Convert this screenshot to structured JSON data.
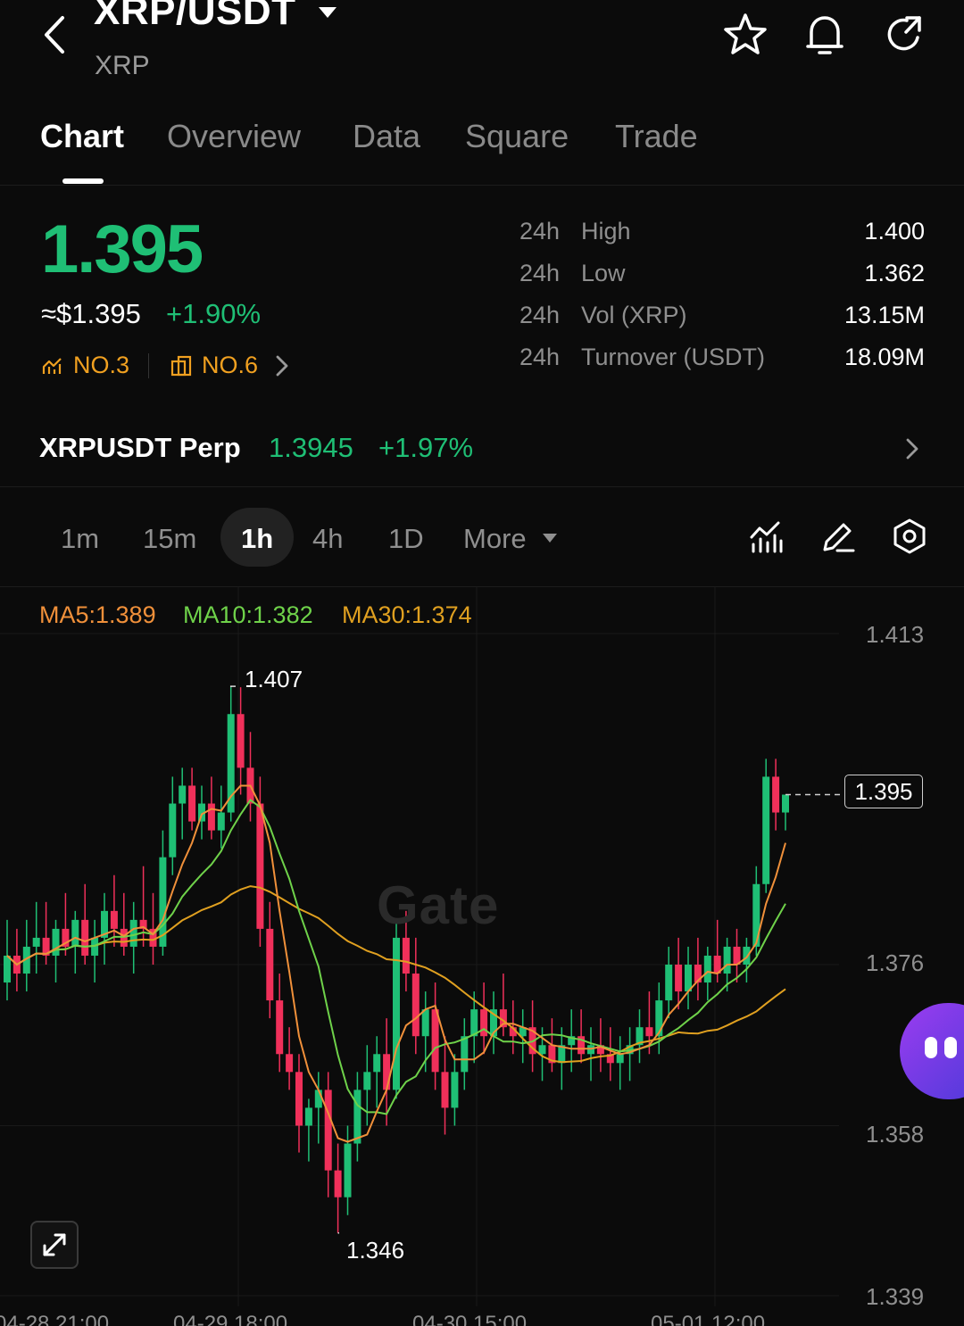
{
  "header": {
    "pair": "XRP/USDT",
    "base_asset": "XRP",
    "icons": [
      "back-icon",
      "star-icon",
      "bell-icon",
      "share-icon"
    ]
  },
  "tabs": [
    {
      "label": "Chart",
      "active": true
    },
    {
      "label": "Overview",
      "active": false
    },
    {
      "label": "Data",
      "active": false
    },
    {
      "label": "Square",
      "active": false
    },
    {
      "label": "Trade",
      "active": false
    }
  ],
  "price": {
    "last": "1.395",
    "usd": "≈$1.395",
    "change_pct": "+1.90%",
    "rank_hot": "NO.3",
    "rank_sector": "NO.6"
  },
  "stats": [
    {
      "period": "24h",
      "label": "High",
      "value": "1.400"
    },
    {
      "period": "24h",
      "label": "Low",
      "value": "1.362"
    },
    {
      "period": "24h",
      "label": "Vol (XRP)",
      "value": "13.15M"
    },
    {
      "period": "24h",
      "label": "Turnover (USDT)",
      "value": "18.09M"
    }
  ],
  "perp": {
    "name": "XRPUSDT Perp",
    "price": "1.3945",
    "change_pct": "+1.97%"
  },
  "intervals": {
    "items": [
      "1m",
      "15m",
      "1h",
      "4h",
      "1D"
    ],
    "active": "1h",
    "more_label": "More"
  },
  "chart": {
    "ma5": "MA5:1.389",
    "ma10": "MA10:1.382",
    "ma30": "MA30:1.374",
    "y_ticks": [
      "1.413",
      "1.376",
      "1.358",
      "1.339"
    ],
    "current_price": "1.395",
    "high_marker": "1.407",
    "low_marker": "1.346",
    "x_ticks": [
      "04-28 21:00",
      "04-29 18:00",
      "04-30 15:00",
      "05-01 12:00"
    ],
    "watermark": "Gate"
  },
  "colors": {
    "up": "#1fbf75",
    "down": "#f0305a",
    "ma5": "#f0903a",
    "ma10": "#6fd24a",
    "ma30": "#e0a020",
    "background": "#0b0b0b"
  },
  "chart_data": {
    "type": "candlestick",
    "interval": "1h",
    "ylim": [
      1.339,
      1.413
    ],
    "y_ticks": [
      1.413,
      1.376,
      1.358,
      1.339
    ],
    "x_ticks": [
      "04-28 21:00",
      "04-29 18:00",
      "04-30 15:00",
      "05-01 12:00"
    ],
    "last_price": 1.395,
    "visible_high": 1.407,
    "visible_low": 1.346,
    "grid": true,
    "candles": [
      {
        "o": 1.374,
        "h": 1.381,
        "l": 1.372,
        "c": 1.377
      },
      {
        "o": 1.377,
        "h": 1.38,
        "l": 1.373,
        "c": 1.375
      },
      {
        "o": 1.375,
        "h": 1.381,
        "l": 1.373,
        "c": 1.378
      },
      {
        "o": 1.378,
        "h": 1.383,
        "l": 1.375,
        "c": 1.379
      },
      {
        "o": 1.379,
        "h": 1.383,
        "l": 1.376,
        "c": 1.377
      },
      {
        "o": 1.377,
        "h": 1.381,
        "l": 1.374,
        "c": 1.38
      },
      {
        "o": 1.38,
        "h": 1.384,
        "l": 1.377,
        "c": 1.378
      },
      {
        "o": 1.378,
        "h": 1.382,
        "l": 1.375,
        "c": 1.381
      },
      {
        "o": 1.381,
        "h": 1.385,
        "l": 1.376,
        "c": 1.377
      },
      {
        "o": 1.377,
        "h": 1.381,
        "l": 1.374,
        "c": 1.379
      },
      {
        "o": 1.379,
        "h": 1.384,
        "l": 1.376,
        "c": 1.382
      },
      {
        "o": 1.382,
        "h": 1.386,
        "l": 1.378,
        "c": 1.38
      },
      {
        "o": 1.38,
        "h": 1.384,
        "l": 1.377,
        "c": 1.378
      },
      {
        "o": 1.378,
        "h": 1.383,
        "l": 1.375,
        "c": 1.381
      },
      {
        "o": 1.381,
        "h": 1.387,
        "l": 1.378,
        "c": 1.38
      },
      {
        "o": 1.38,
        "h": 1.384,
        "l": 1.376,
        "c": 1.378
      },
      {
        "o": 1.378,
        "h": 1.391,
        "l": 1.377,
        "c": 1.388
      },
      {
        "o": 1.388,
        "h": 1.397,
        "l": 1.386,
        "c": 1.394
      },
      {
        "o": 1.394,
        "h": 1.398,
        "l": 1.39,
        "c": 1.396
      },
      {
        "o": 1.396,
        "h": 1.398,
        "l": 1.391,
        "c": 1.392
      },
      {
        "o": 1.392,
        "h": 1.396,
        "l": 1.39,
        "c": 1.394
      },
      {
        "o": 1.394,
        "h": 1.397,
        "l": 1.39,
        "c": 1.391
      },
      {
        "o": 1.391,
        "h": 1.396,
        "l": 1.389,
        "c": 1.393
      },
      {
        "o": 1.393,
        "h": 1.407,
        "l": 1.392,
        "c": 1.404
      },
      {
        "o": 1.404,
        "h": 1.407,
        "l": 1.395,
        "c": 1.398
      },
      {
        "o": 1.398,
        "h": 1.402,
        "l": 1.392,
        "c": 1.394
      },
      {
        "o": 1.394,
        "h": 1.397,
        "l": 1.378,
        "c": 1.38
      },
      {
        "o": 1.38,
        "h": 1.383,
        "l": 1.37,
        "c": 1.372
      },
      {
        "o": 1.372,
        "h": 1.375,
        "l": 1.364,
        "c": 1.366
      },
      {
        "o": 1.366,
        "h": 1.369,
        "l": 1.362,
        "c": 1.364
      },
      {
        "o": 1.364,
        "h": 1.366,
        "l": 1.355,
        "c": 1.358
      },
      {
        "o": 1.358,
        "h": 1.361,
        "l": 1.354,
        "c": 1.36
      },
      {
        "o": 1.36,
        "h": 1.364,
        "l": 1.356,
        "c": 1.362
      },
      {
        "o": 1.362,
        "h": 1.364,
        "l": 1.35,
        "c": 1.353
      },
      {
        "o": 1.353,
        "h": 1.356,
        "l": 1.346,
        "c": 1.35
      },
      {
        "o": 1.35,
        "h": 1.358,
        "l": 1.348,
        "c": 1.356
      },
      {
        "o": 1.356,
        "h": 1.364,
        "l": 1.354,
        "c": 1.362
      },
      {
        "o": 1.362,
        "h": 1.367,
        "l": 1.358,
        "c": 1.364
      },
      {
        "o": 1.364,
        "h": 1.368,
        "l": 1.36,
        "c": 1.366
      },
      {
        "o": 1.366,
        "h": 1.37,
        "l": 1.358,
        "c": 1.362
      },
      {
        "o": 1.362,
        "h": 1.381,
        "l": 1.361,
        "c": 1.379
      },
      {
        "o": 1.379,
        "h": 1.382,
        "l": 1.373,
        "c": 1.375
      },
      {
        "o": 1.375,
        "h": 1.379,
        "l": 1.366,
        "c": 1.368
      },
      {
        "o": 1.368,
        "h": 1.373,
        "l": 1.364,
        "c": 1.371
      },
      {
        "o": 1.371,
        "h": 1.374,
        "l": 1.362,
        "c": 1.364
      },
      {
        "o": 1.364,
        "h": 1.368,
        "l": 1.357,
        "c": 1.36
      },
      {
        "o": 1.36,
        "h": 1.366,
        "l": 1.358,
        "c": 1.364
      },
      {
        "o": 1.364,
        "h": 1.37,
        "l": 1.362,
        "c": 1.368
      },
      {
        "o": 1.368,
        "h": 1.373,
        "l": 1.365,
        "c": 1.371
      },
      {
        "o": 1.371,
        "h": 1.374,
        "l": 1.366,
        "c": 1.368
      },
      {
        "o": 1.368,
        "h": 1.373,
        "l": 1.366,
        "c": 1.371
      },
      {
        "o": 1.371,
        "h": 1.375,
        "l": 1.368,
        "c": 1.369
      },
      {
        "o": 1.369,
        "h": 1.372,
        "l": 1.366,
        "c": 1.368
      },
      {
        "o": 1.368,
        "h": 1.371,
        "l": 1.365,
        "c": 1.369
      },
      {
        "o": 1.369,
        "h": 1.372,
        "l": 1.364,
        "c": 1.366
      },
      {
        "o": 1.366,
        "h": 1.369,
        "l": 1.363,
        "c": 1.367
      },
      {
        "o": 1.367,
        "h": 1.37,
        "l": 1.364,
        "c": 1.365
      },
      {
        "o": 1.365,
        "h": 1.369,
        "l": 1.362,
        "c": 1.367
      },
      {
        "o": 1.367,
        "h": 1.371,
        "l": 1.364,
        "c": 1.368
      },
      {
        "o": 1.368,
        "h": 1.371,
        "l": 1.365,
        "c": 1.366
      },
      {
        "o": 1.366,
        "h": 1.369,
        "l": 1.363,
        "c": 1.367
      },
      {
        "o": 1.367,
        "h": 1.37,
        "l": 1.364,
        "c": 1.366
      },
      {
        "o": 1.366,
        "h": 1.369,
        "l": 1.363,
        "c": 1.365
      },
      {
        "o": 1.365,
        "h": 1.368,
        "l": 1.362,
        "c": 1.366
      },
      {
        "o": 1.366,
        "h": 1.369,
        "l": 1.363,
        "c": 1.367
      },
      {
        "o": 1.367,
        "h": 1.371,
        "l": 1.365,
        "c": 1.369
      },
      {
        "o": 1.369,
        "h": 1.373,
        "l": 1.366,
        "c": 1.368
      },
      {
        "o": 1.368,
        "h": 1.374,
        "l": 1.366,
        "c": 1.372
      },
      {
        "o": 1.372,
        "h": 1.378,
        "l": 1.37,
        "c": 1.376
      },
      {
        "o": 1.376,
        "h": 1.379,
        "l": 1.371,
        "c": 1.373
      },
      {
        "o": 1.373,
        "h": 1.378,
        "l": 1.371,
        "c": 1.376
      },
      {
        "o": 1.376,
        "h": 1.379,
        "l": 1.372,
        "c": 1.374
      },
      {
        "o": 1.374,
        "h": 1.378,
        "l": 1.372,
        "c": 1.377
      },
      {
        "o": 1.377,
        "h": 1.381,
        "l": 1.374,
        "c": 1.375
      },
      {
        "o": 1.375,
        "h": 1.379,
        "l": 1.373,
        "c": 1.378
      },
      {
        "o": 1.378,
        "h": 1.38,
        "l": 1.374,
        "c": 1.376
      },
      {
        "o": 1.376,
        "h": 1.379,
        "l": 1.374,
        "c": 1.378
      },
      {
        "o": 1.378,
        "h": 1.387,
        "l": 1.377,
        "c": 1.385
      },
      {
        "o": 1.385,
        "h": 1.399,
        "l": 1.384,
        "c": 1.397
      },
      {
        "o": 1.397,
        "h": 1.399,
        "l": 1.391,
        "c": 1.393
      },
      {
        "o": 1.393,
        "h": 1.395,
        "l": 1.391,
        "c": 1.395
      }
    ]
  }
}
